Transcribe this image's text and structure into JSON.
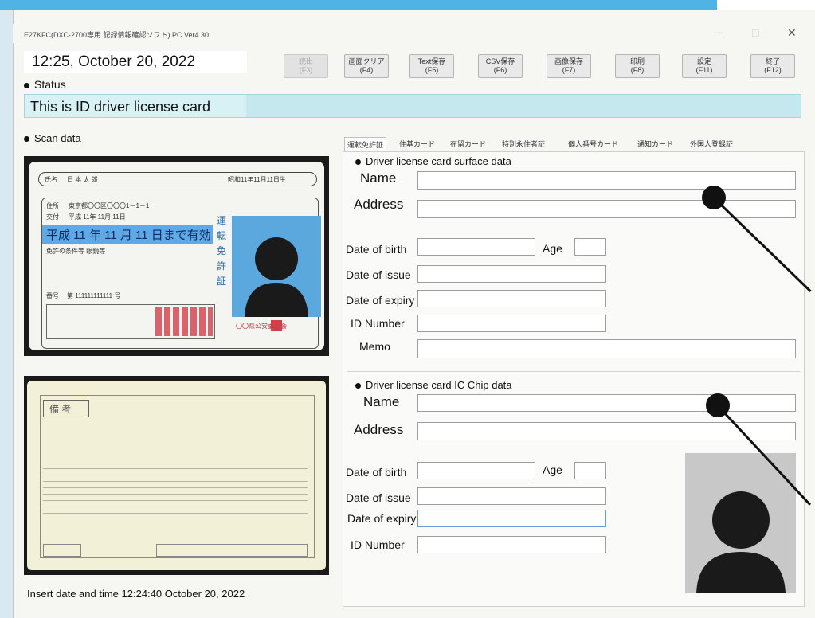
{
  "app": {
    "title": "E27KFC(DXC-2700専用 記録情報確認ソフト) PC Ver4.30",
    "window_controls": {
      "minimize": "−",
      "maximize": "□",
      "close": "✕"
    }
  },
  "header": {
    "datetime": "12:25,  October 20, 2022",
    "buttons": [
      {
        "jp": "読出",
        "key": "(F3)",
        "enabled": false
      },
      {
        "jp": "画面クリア",
        "key": "(F4)",
        "enabled": true
      },
      {
        "jp": "Text保存",
        "key": "(F5)",
        "enabled": true
      },
      {
        "jp": "CSV保存",
        "key": "(F6)",
        "enabled": true
      },
      {
        "jp": "画像保存",
        "key": "(F7)",
        "enabled": true
      },
      {
        "jp": "印刷",
        "key": "(F8)",
        "enabled": true
      },
      {
        "jp": "設定",
        "key": "(F11)",
        "enabled": true
      },
      {
        "jp": "終了",
        "key": "(F12)",
        "enabled": true
      }
    ]
  },
  "status": {
    "label": "Status",
    "message": "This is ID driver license card"
  },
  "scan": {
    "label": "Scan data",
    "insert_date": "Insert  date and time  12:24:40 October 20, 2022",
    "front_card": {
      "name_label": "氏名",
      "name_value": "日 本 太 郎",
      "birth": "昭和11年11月11日生",
      "address_label": "住所",
      "address_value": "東京都〇〇区〇〇〇1－1－1",
      "issue_label": "交付",
      "issue_value": "平成 11年 11月 11日",
      "validity": "平成 11 年 11 月 11 日まで有効",
      "conditions": "免許の条件等  眼鏡等",
      "number_label": "番号",
      "number_value": "第  111111111111  号",
      "license_types": "運転免許証",
      "issuer": "〇〇県公安委員会"
    },
    "back_card": {
      "remarks_label": "備 考"
    }
  },
  "tabs": [
    "運転免許証",
    "住基カード",
    "在留カード",
    "特別永住者証",
    "個人番号カード",
    "通知カード",
    "外国人登録証"
  ],
  "surface": {
    "section_label": "Driver license card surface data",
    "name_label": "Name",
    "address_label": "Address",
    "dob_label": "Date of birth",
    "age_label": "Age",
    "issue_label": "Date of issue",
    "expiry_label": "Date of expiry",
    "idnum_label": "ID Number",
    "memo_label": "Memo"
  },
  "chip": {
    "section_label": "Driver license card IC Chip data",
    "name_label": "Name",
    "address_label": "Address",
    "dob_label": "Date of birth",
    "age_label": "Age",
    "issue_label": "Date of issue",
    "expiry_label": "Date of expiry",
    "idnum_label": "ID Number"
  },
  "colors": {
    "frame_accent": "#4fb3e6",
    "status_bar": "#c5e8ef",
    "card_validity_band": "#5ea9e6",
    "photo_background": "#5aa8de"
  },
  "icons": {
    "bullet": "bullet-icon",
    "person_silhouette": "person-silhouette-icon"
  }
}
